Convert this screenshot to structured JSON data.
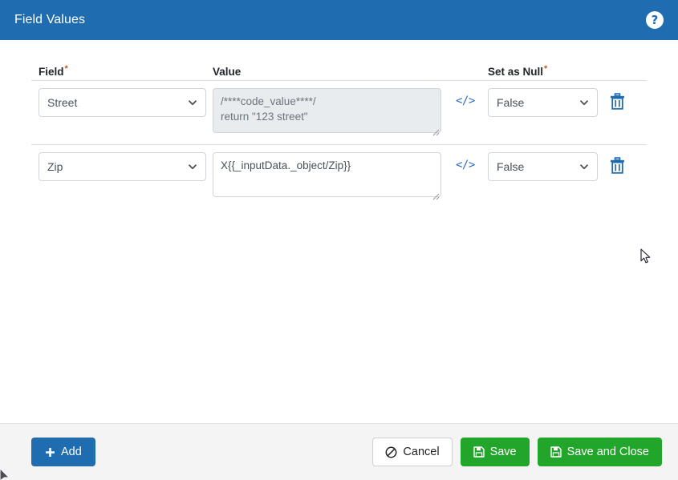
{
  "header": {
    "title": "Field Values",
    "help_icon": "help-circle-icon",
    "help_glyph": "?",
    "bg_color": "#1f6cb0"
  },
  "table": {
    "columns": [
      {
        "label": "Field",
        "required": true,
        "required_mark": "*"
      },
      {
        "label": "Value",
        "required": false,
        "required_mark": ""
      },
      {
        "label": "Set as Null",
        "required": true,
        "required_mark": "*"
      }
    ],
    "rows": [
      {
        "field": "Street",
        "value": "/****code_value****/\nreturn \"123 street\"",
        "value_disabled": true,
        "code_icon": "</>",
        "set_as_null": "False",
        "delete_icon": "trash-icon"
      },
      {
        "field": "Zip",
        "value": "X{{_inputData._object/Zip}}",
        "value_disabled": false,
        "code_icon": "</>",
        "set_as_null": "False",
        "delete_icon": "trash-icon"
      }
    ]
  },
  "footer": {
    "add_label": "Add",
    "add_icon": "plus-icon",
    "cancel_label": "Cancel",
    "cancel_icon": "ban-icon",
    "save_label": "Save",
    "save_icon": "floppy-disk-icon",
    "save_close_label": "Save and Close",
    "save_close_icon": "floppy-disk-icon"
  },
  "colors": {
    "header_blue": "#1f6cb0",
    "accent_blue": "#2b6cc4",
    "green": "#22a52b",
    "required_asterisk": "#c0561f",
    "footer_bg": "#f4f4f4",
    "disabled_bg": "#e9ecef"
  }
}
